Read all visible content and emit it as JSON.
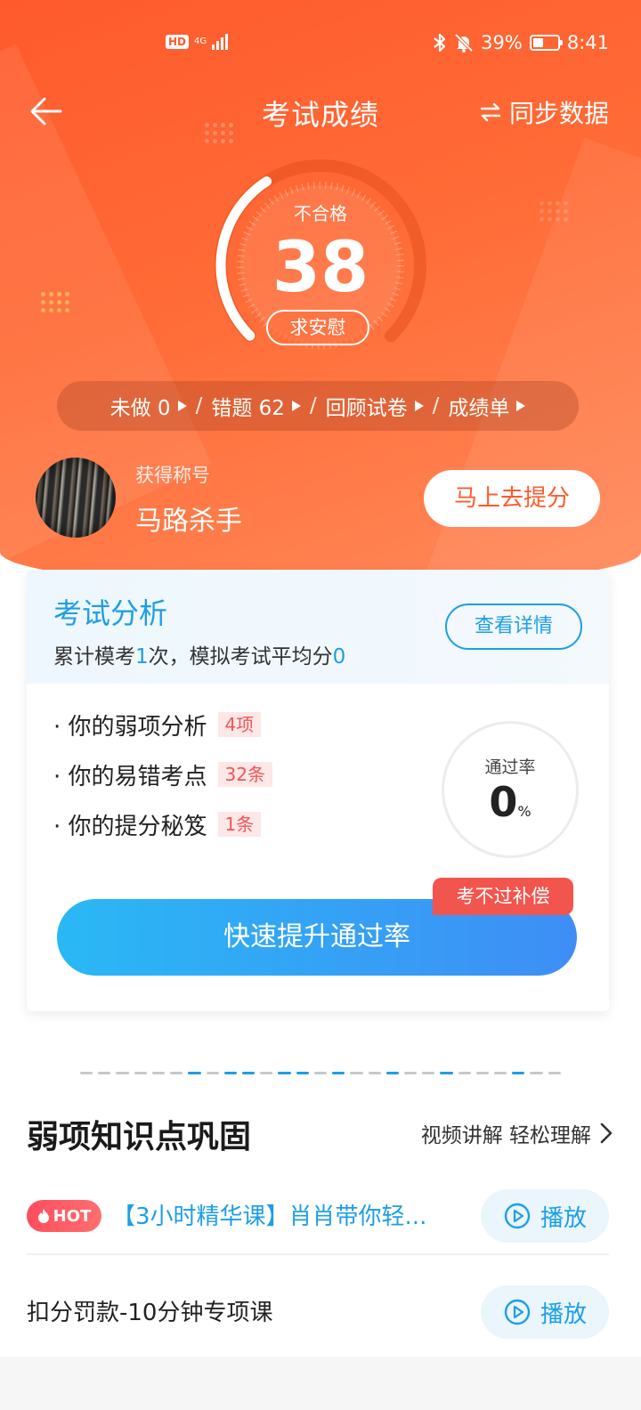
{
  "status_bar": {
    "hd": "HD",
    "network": "4G",
    "battery": "39%",
    "time": "8:41"
  },
  "nav": {
    "title": "考试成绩",
    "sync_label": "同步数据"
  },
  "score": {
    "label": "不合格",
    "value": "38",
    "badge": "求安慰"
  },
  "summary_bar": {
    "undone": "未做 0",
    "wrong": "错题  62",
    "review": "回顾试卷",
    "report": "成绩单",
    "separator": "/"
  },
  "profile": {
    "caption": "获得称号",
    "title": "马路杀手",
    "improve_button": "马上去提分"
  },
  "analysis": {
    "title": "考试分析",
    "summary_prefix": "累计模考",
    "exam_count": "1",
    "summary_middle": "次，模拟考试平均分",
    "average": "0",
    "details_button": "查看详情",
    "items": [
      {
        "label": "· 你的弱项分析",
        "tag": "4项"
      },
      {
        "label": "· 你的易错考点",
        "tag": "32条"
      },
      {
        "label": "· 你的提分秘笈",
        "tag": "1条"
      }
    ],
    "pass_label": "通过率",
    "pass_value": "0",
    "pass_unit": "%",
    "guarantee_badge": "考不过补偿",
    "boost_button": "快速提升通过率"
  },
  "weak_points": {
    "title": "弱项知识点巩固",
    "link": "视频讲解 轻松理解",
    "courses": [
      {
        "hot": "HOT",
        "title": "【3小时精华课】肖肖带你轻...",
        "play": "播放"
      },
      {
        "title": "扣分罚款-10分钟专项课",
        "play": "播放"
      }
    ]
  },
  "colors": {
    "accent_orange": "#ff5a2c",
    "accent_blue": "#1d9ee5",
    "tag_red": "#f05656"
  }
}
